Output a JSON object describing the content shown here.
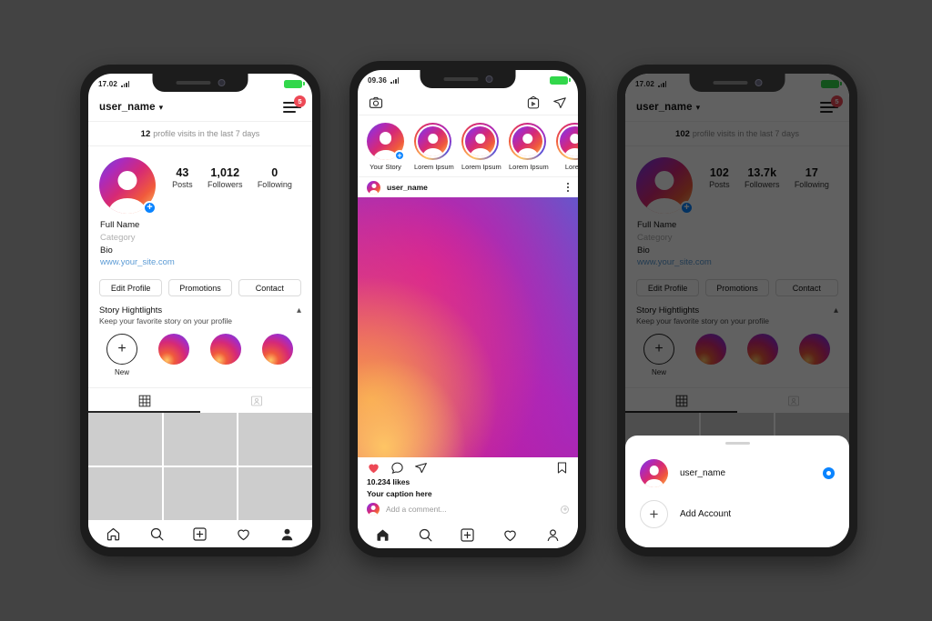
{
  "theme": {
    "background": "#434343",
    "accent_blue": "#0a84ff",
    "badge_red": "#ed4956",
    "link_blue": "#5b9bd5",
    "gradient": "#5b51d8 #a82bc0 #d62976 #f05a3c #fec564"
  },
  "phone1": {
    "status": {
      "time": "17.02",
      "battery_icon": "battery-icon",
      "signal_icon": "signal-icon"
    },
    "header": {
      "username": "user_name",
      "chevron_icon": "chevron-down-icon",
      "menu_icon": "hamburger-menu-icon",
      "badge_count": "5"
    },
    "visits": {
      "count": "12",
      "text": "profile visits in the last 7 days"
    },
    "stats": [
      {
        "num": "43",
        "label": "Posts"
      },
      {
        "num": "1,012",
        "label": "Followers"
      },
      {
        "num": "0",
        "label": "Following"
      }
    ],
    "bio": {
      "full_name": "Full Name",
      "category": "Category",
      "bio": "Bio",
      "website": "www.your_site.com"
    },
    "actions": [
      "Edit Profile",
      "Promotions",
      "Contact"
    ],
    "highlights": {
      "title": "Story Hightlights",
      "subtitle": "Keep your favorite story on your profile",
      "collapse_icon": "chevron-up-icon",
      "new_label": "New",
      "new_plus": "+",
      "items": [
        "highlight-1",
        "highlight-2",
        "highlight-3"
      ]
    },
    "tabs": [
      {
        "name": "grid-tab",
        "icon": "grid-icon",
        "active": true
      },
      {
        "name": "tagged-tab",
        "icon": "tagged-person-icon",
        "active": false
      }
    ],
    "bottom_nav": [
      "home-icon",
      "search-icon",
      "add-post-icon",
      "heart-icon",
      "profile-icon"
    ]
  },
  "phone2": {
    "status": {
      "time": "09.36"
    },
    "topbar": {
      "camera_icon": "camera-icon",
      "igtv_icon": "igtv-icon",
      "send_icon": "direct-send-icon"
    },
    "stories": [
      {
        "label": "Your Story",
        "own": true
      },
      {
        "label": "Lorem Ipsum",
        "own": false
      },
      {
        "label": "Lorem Ipsum",
        "own": false
      },
      {
        "label": "Lorem Ipsum",
        "own": false
      },
      {
        "label": "Lorem",
        "own": false
      }
    ],
    "post": {
      "username": "user_name",
      "more_icon": "more-options-icon",
      "like_icon": "heart-filled-icon",
      "comment_icon": "comment-icon",
      "share_icon": "direct-send-icon",
      "save_icon": "bookmark-icon",
      "likes": "10.234 likes",
      "caption": "Your caption here",
      "comment_placeholder": "Add a comment...",
      "emoji_icon": "add-emoji-icon"
    },
    "bottom_nav": [
      "home-icon",
      "search-icon",
      "add-post-icon",
      "heart-icon",
      "profile-icon"
    ]
  },
  "phone3": {
    "status": {
      "time": "17.02"
    },
    "header": {
      "username": "user_name",
      "chevron_icon": "chevron-down-icon",
      "menu_icon": "hamburger-menu-icon",
      "badge_count": "5"
    },
    "visits": {
      "count": "102",
      "text": "profile visits in the last 7 days"
    },
    "stats": [
      {
        "num": "102",
        "label": "Posts"
      },
      {
        "num": "13.7k",
        "label": "Followers"
      },
      {
        "num": "17",
        "label": "Following"
      }
    ],
    "bio": {
      "full_name": "Full Name",
      "category": "Category",
      "bio": "Bio",
      "website": "www.your_site.com"
    },
    "actions": [
      "Edit Profile",
      "Promotions",
      "Contact"
    ],
    "highlights": {
      "title": "Story Hightlights",
      "subtitle": "Keep your favorite story on your profile",
      "new_label": "New",
      "new_plus": "+"
    },
    "sheet": {
      "grabber": "drag-handle",
      "account_name": "user_name",
      "selected_icon": "radio-selected-icon",
      "add_account_label": "Add Account",
      "add_plus": "+"
    }
  }
}
